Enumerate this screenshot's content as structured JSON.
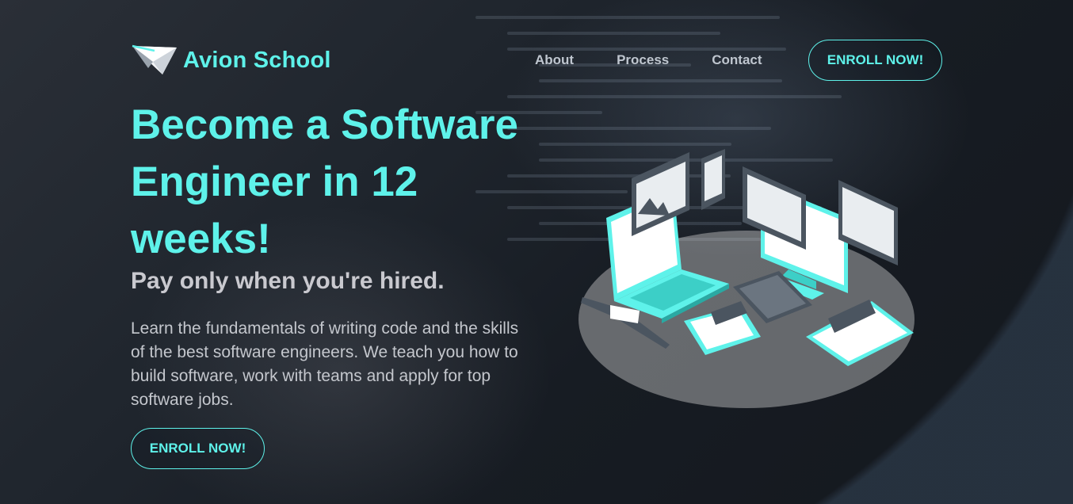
{
  "brand": {
    "name": "Avion School",
    "logo_icon": "paper-plane-icon"
  },
  "nav": {
    "links": [
      "About",
      "Process",
      "Contact"
    ],
    "cta_label": "ENROLL NOW!"
  },
  "hero": {
    "title": "Become a Software Engineer in 12 weeks!",
    "subtitle": "Pay only when you're hired.",
    "description": "Learn the fundamentals of writing code and the skills of the best software engineers. We teach you how to build software, work with teams and apply for top software jobs.",
    "cta_label": "ENROLL NOW!",
    "illustration": "isometric-devices-icon"
  },
  "colors": {
    "accent": "#5ef2ea",
    "text_muted": "#c4c7cd",
    "background": "#1b2430"
  }
}
